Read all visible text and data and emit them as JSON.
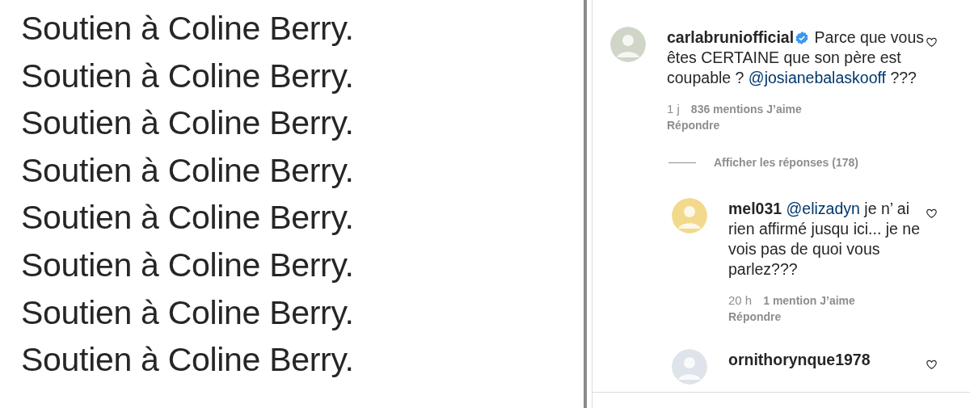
{
  "post_image": {
    "lines": [
      "Soutien à Coline Berry.",
      "Soutien à Coline Berry.",
      "Soutien à Coline Berry.",
      "Soutien à Coline Berry.",
      "Soutien à Coline Berry.",
      "Soutien à Coline Berry.",
      "Soutien à Coline Berry.",
      "Soutien à Coline Berry."
    ]
  },
  "comments": [
    {
      "kind": "top",
      "username": "carlabruniofficial",
      "verified": true,
      "segments": [
        {
          "kind": "plain",
          "text": "Parce que vous êtes CERTAINE que son père est coupable ?"
        },
        {
          "kind": "mention",
          "text": "@josianebalaskooff"
        },
        {
          "kind": "plain",
          "text": "???"
        }
      ],
      "time": "1 j",
      "likes": "836 mentions J’aime",
      "reply": "Répondre",
      "view_replies": "Afficher les réponses (178)"
    },
    {
      "kind": "reply",
      "username": "mel031",
      "verified": false,
      "segments": [
        {
          "kind": "mention",
          "text": "@elizadyn"
        },
        {
          "kind": "plain",
          "text": "je n’ ai rien affirmé jusqu ici... je ne vois pas de quoi vous parlez???"
        }
      ],
      "time": "20 h",
      "likes": "1 mention J’aime",
      "reply": "Répondre"
    },
    {
      "kind": "reply",
      "username": "ornithorynque1978",
      "verified": false
    }
  ]
}
